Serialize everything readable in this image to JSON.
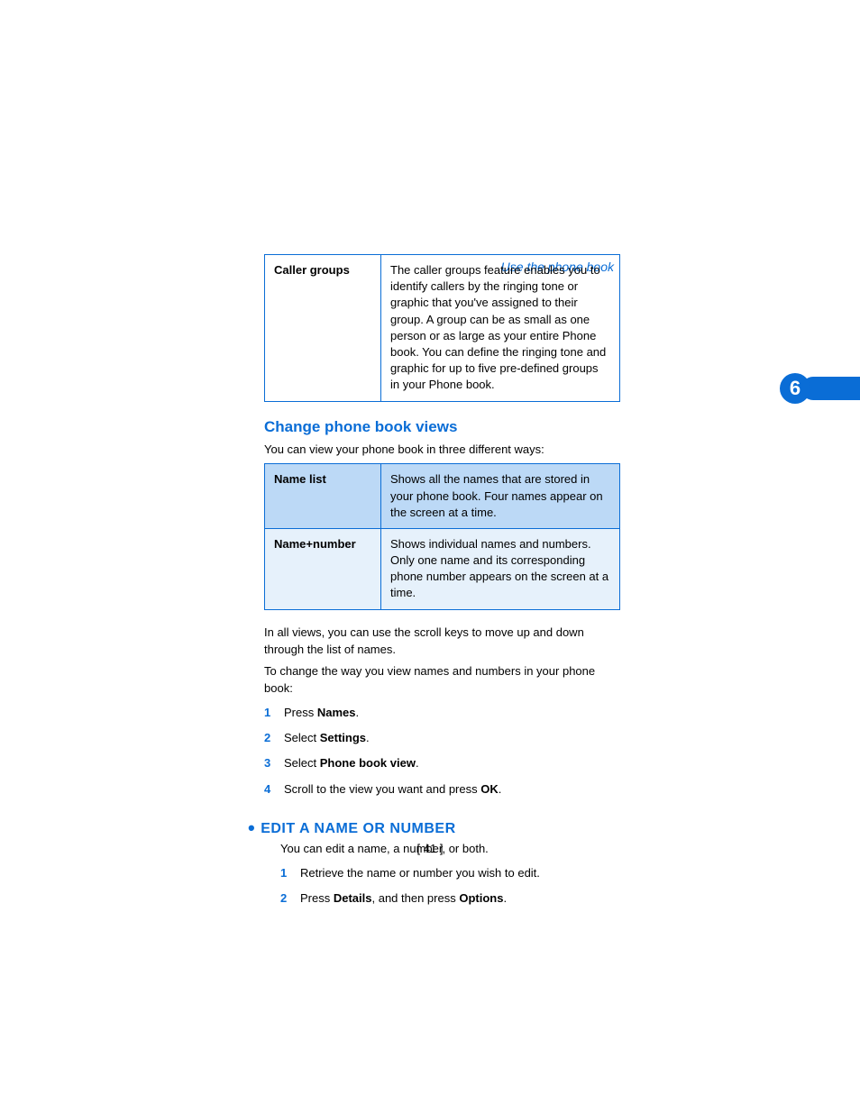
{
  "header": {
    "section_link": "Use the phone book"
  },
  "chapter": {
    "number": "6"
  },
  "table1": {
    "row_label": "Caller groups",
    "row_text": "The caller groups feature enables you to identify callers by the ringing tone or graphic that you've assigned to their group. A group can be as small as one person or as large as your entire Phone book. You can define the ringing tone and graphic for up to five pre-defined groups in your Phone book."
  },
  "section_change": {
    "title": "Change phone book views",
    "intro": "You can view your phone book in three different ways:"
  },
  "table2": {
    "rows": [
      {
        "label": "Name list",
        "text": "Shows all the names that are stored in your phone book. Four names appear on the screen at a time."
      },
      {
        "label": "Name+number",
        "text": "Shows individual names and numbers. Only one name and its corresponding phone number appears on the screen at a time."
      }
    ]
  },
  "after_table2": {
    "p1": "In all views, you can use the scroll keys to move up and down through the list of names.",
    "p2": "To change the way you view names and numbers in your phone book:"
  },
  "steps1": {
    "s1_pre": "Press ",
    "s1_bold": "Names",
    "s1_post": ".",
    "s2_pre": "Select ",
    "s2_bold": "Settings",
    "s2_post": ".",
    "s3_pre": "Select ",
    "s3_bold": "Phone book view",
    "s3_post": ".",
    "s4_pre": "Scroll to the view you want and press ",
    "s4_bold": "OK",
    "s4_post": "."
  },
  "section_edit": {
    "title": "EDIT A NAME OR NUMBER",
    "intro": "You can edit a name, a number, or both."
  },
  "steps2": {
    "s1": "Retrieve the name or number you wish to edit.",
    "s2_pre": "Press ",
    "s2_b1": "Details",
    "s2_mid": ", and then press ",
    "s2_b2": "Options",
    "s2_post": "."
  },
  "footer": {
    "page": "[ 41 ]"
  }
}
